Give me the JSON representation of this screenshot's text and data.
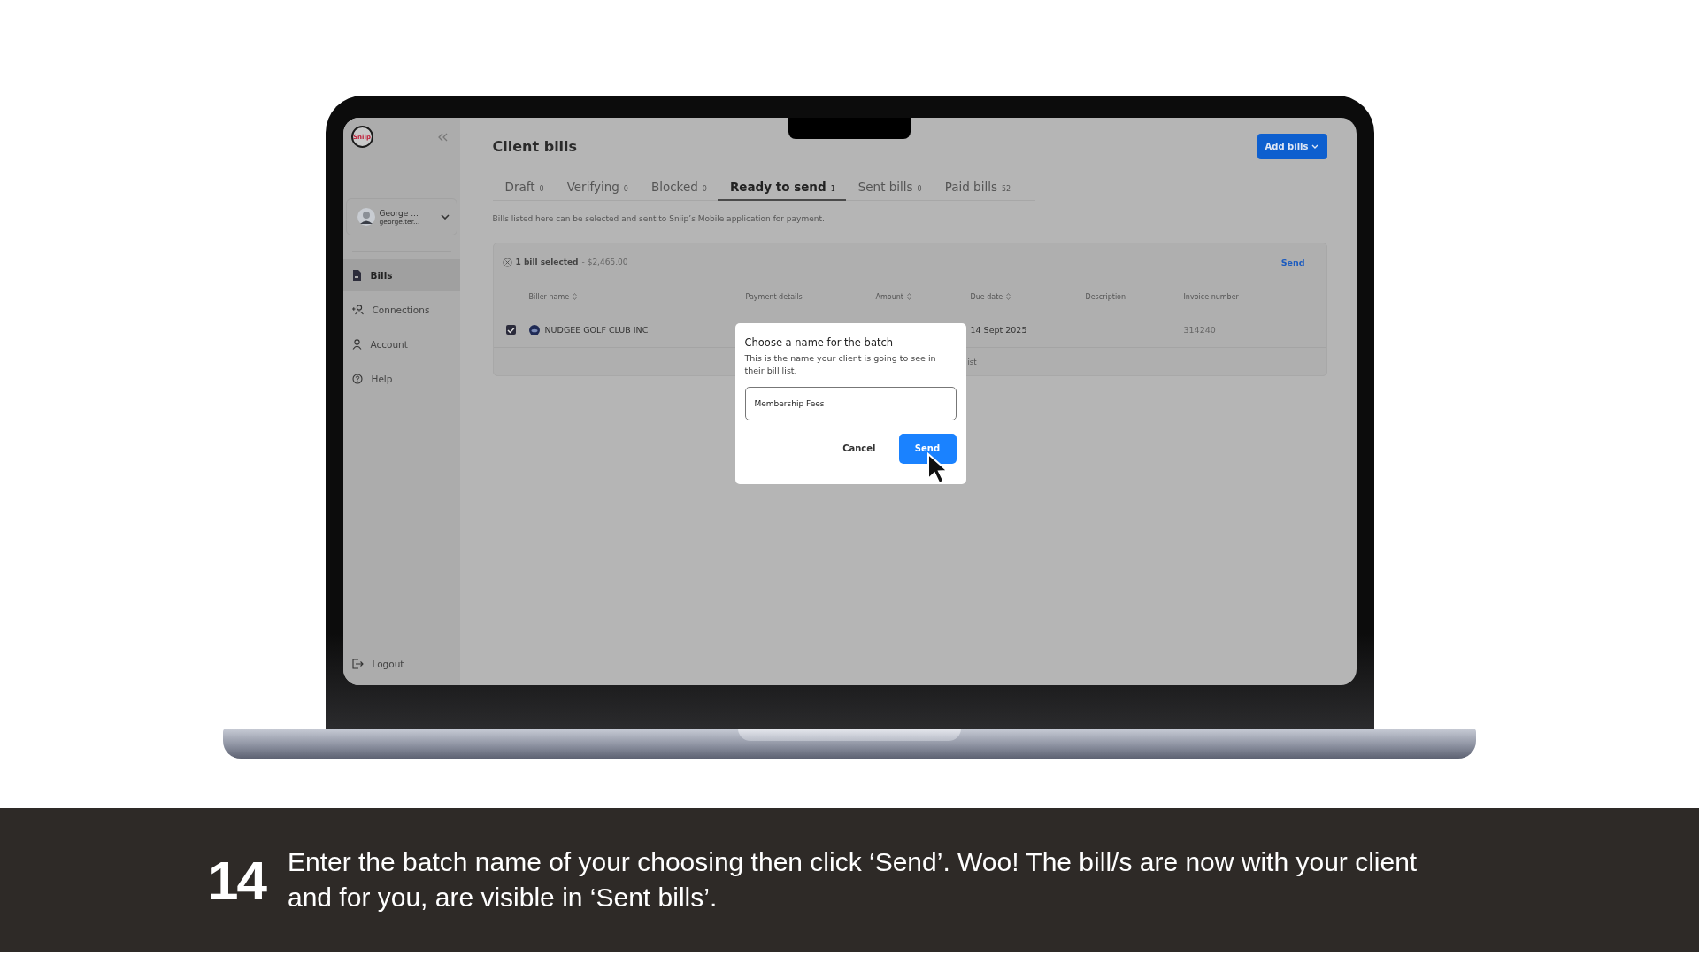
{
  "app": {
    "sidebar": {
      "logo": "Sniip",
      "user": {
        "name": "George ...",
        "email": "george.ter..."
      },
      "items": [
        {
          "label": "Bills",
          "selected": true
        },
        {
          "label": "Connections",
          "selected": false
        },
        {
          "label": "Account",
          "selected": false
        },
        {
          "label": "Help",
          "selected": false
        }
      ],
      "footer_item": "Logout"
    },
    "header": {
      "title": "Client bills",
      "add_button": "Add bills"
    },
    "tabs": [
      {
        "label": "Draft",
        "count": "0",
        "selected": false
      },
      {
        "label": "Verifying",
        "count": "0",
        "selected": false
      },
      {
        "label": "Blocked",
        "count": "0",
        "selected": false
      },
      {
        "label": "Ready to send",
        "count": "1",
        "selected": true
      },
      {
        "label": "Sent bills",
        "count": "0",
        "selected": false
      },
      {
        "label": "Paid bills",
        "count": "52",
        "selected": false
      }
    ],
    "description": "Bills listed here can be selected and sent to Sniip’s Mobile application for payment.",
    "selection_bar": {
      "summary": "1 bill selected",
      "amount": "- $2,465.00",
      "action": "Send"
    },
    "table": {
      "columns": [
        {
          "label": "Biller name",
          "sortable": true
        },
        {
          "label": "Payment details",
          "sortable": false
        },
        {
          "label": "Amount",
          "sortable": true
        },
        {
          "label": "Due date",
          "sortable": true
        },
        {
          "label": "Description",
          "sortable": false
        },
        {
          "label": "Invoice number",
          "sortable": false
        }
      ],
      "rows": [
        {
          "checked": true,
          "biller": "NUDGEE GOLF CLUB INC",
          "due_date": "14 Sept 2025",
          "invoice_number": "314240"
        }
      ],
      "footer_text": "ist"
    },
    "dialog": {
      "title": "Choose a name for the batch",
      "text": "This is the name your client is going to see in their bill list.",
      "input_value": "Membership Fees",
      "buttons": [
        {
          "label": "Cancel",
          "kind": "secondary"
        },
        {
          "label": "Send",
          "kind": "primary"
        }
      ]
    }
  },
  "caption": {
    "step": "14",
    "text": "Enter the batch name of your choosing then click ‘Send’. Woo! The bill/s are now with your client and for you, are visible in ‘Sent bills’."
  }
}
